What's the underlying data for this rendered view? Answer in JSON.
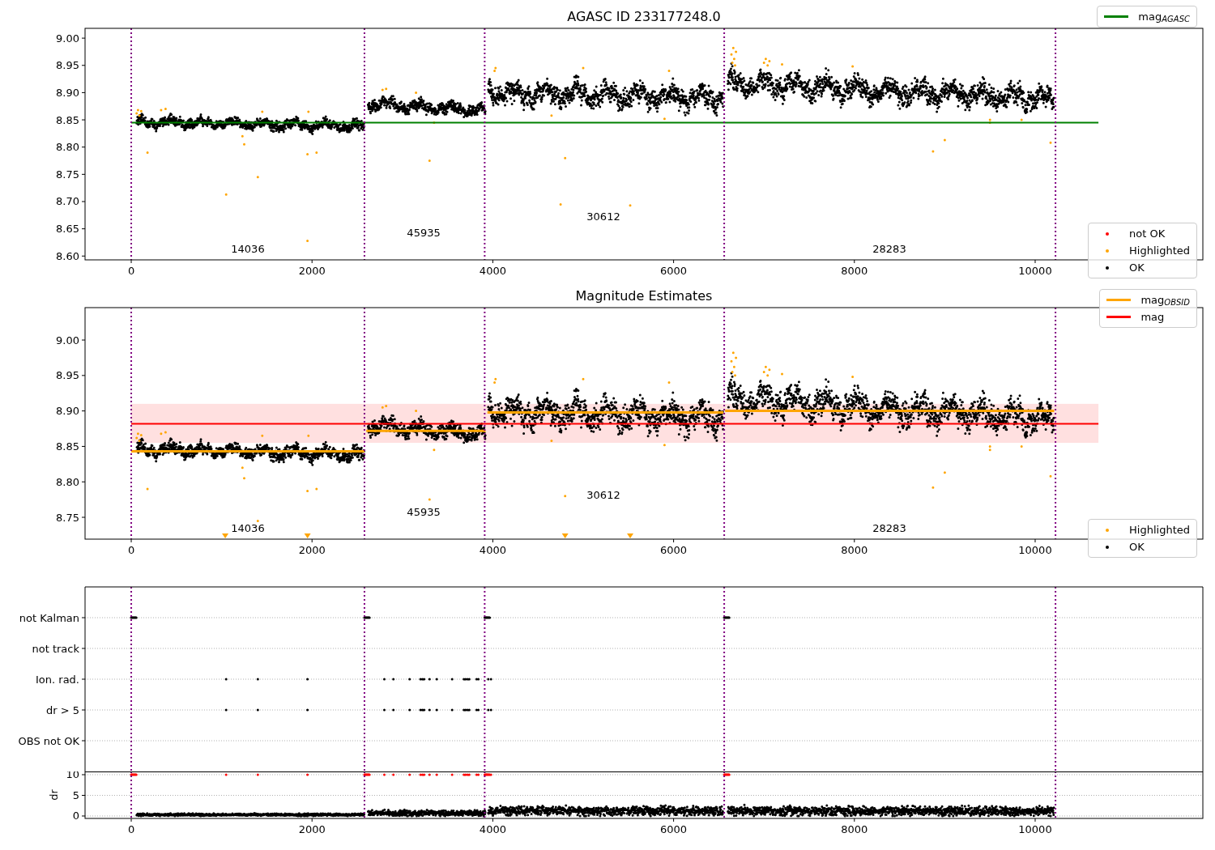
{
  "panels": [
    {
      "kind": "magnitude",
      "title": "AGASC ID 233177248.0",
      "chart_data": {
        "type": "line",
        "x": [
          0,
          10700
        ],
        "xlim": [
          -511,
          11855
        ],
        "ylim": [
          8.593,
          9.018
        ],
        "xticks": [
          0,
          2000,
          4000,
          6000,
          8000,
          10000
        ],
        "yticks": [
          {
            "value": 8.6,
            "label": "8.60"
          },
          {
            "value": 8.65,
            "label": "8.65"
          },
          {
            "value": 8.7,
            "label": "8.70"
          },
          {
            "value": 8.75,
            "label": "8.75"
          },
          {
            "value": 8.8,
            "label": "8.80"
          },
          {
            "value": 8.85,
            "label": "8.85"
          },
          {
            "value": 8.9,
            "label": "8.90"
          },
          {
            "value": 8.95,
            "label": "8.95"
          },
          {
            "value": 9.0,
            "label": "9.00"
          }
        ],
        "series": [
          {
            "name": "mag$_{AGASC}$",
            "color": "#008000",
            "values": [
              8.845,
              8.845
            ]
          }
        ],
        "ref_lines": [
          {
            "axis": "x",
            "value": 0,
            "color": "#800080"
          },
          {
            "axis": "x",
            "value": 2580,
            "color": "#800080"
          },
          {
            "axis": "x",
            "value": 3910,
            "color": "#800080"
          },
          {
            "axis": "x",
            "value": 6560,
            "color": "#800080"
          },
          {
            "axis": "x",
            "value": 10225,
            "color": "#800080"
          }
        ],
        "annotations": [
          "14036",
          "45935",
          "30612",
          "28283"
        ]
      },
      "marker_legend": [
        {
          "label": "not OK",
          "color": "#ff0000"
        },
        {
          "label": "Highlighted",
          "color": "#ffa500"
        },
        {
          "label": "OK",
          "color": "#000000"
        }
      ]
    },
    {
      "kind": "magnitude",
      "title": "Magnitude Estimates",
      "chart_data": {
        "type": "line",
        "x": [
          0,
          2580,
          2590,
          2600,
          3920,
          3930,
          3940,
          6550,
          6560,
          6570,
          10210,
          10700
        ],
        "xlim": [
          -511,
          11855
        ],
        "ylim": [
          8.7192,
          9.0457
        ],
        "xticks": [
          0,
          2000,
          4000,
          6000,
          8000,
          10000
        ],
        "yticks": [
          {
            "value": 8.75,
            "label": "8.75"
          },
          {
            "value": 8.8,
            "label": "8.80"
          },
          {
            "value": 8.85,
            "label": "8.85"
          },
          {
            "value": 8.9,
            "label": "8.90"
          },
          {
            "value": 8.95,
            "label": "8.95"
          },
          {
            "value": 9.0,
            "label": "9.00"
          }
        ],
        "series": [
          {
            "name": "mag$_{OBSID}$",
            "color": "#ffa500",
            "values": [
              8.843,
              8.843,
              null,
              8.872,
              8.872,
              null,
              8.898,
              8.898,
              null,
              8.9,
              8.9,
              null
            ]
          },
          {
            "name": "mag",
            "color": "#ff0000",
            "values": [
              8.882,
              8.882,
              8.882,
              8.882,
              8.882,
              8.882,
              8.882,
              8.882,
              8.882,
              8.882,
              8.882,
              8.882
            ]
          }
        ],
        "bands": [
          {
            "axis": "y",
            "from": 8.855,
            "to": 8.91,
            "color": "#ff0000"
          }
        ],
        "ref_lines": [
          {
            "axis": "x",
            "value": 0,
            "color": "#800080"
          },
          {
            "axis": "x",
            "value": 2580,
            "color": "#800080"
          },
          {
            "axis": "x",
            "value": 3910,
            "color": "#800080"
          },
          {
            "axis": "x",
            "value": 6560,
            "color": "#800080"
          },
          {
            "axis": "x",
            "value": 10225,
            "color": "#800080"
          }
        ],
        "annotations": [
          "14036",
          "45935",
          "30612",
          "28283"
        ]
      },
      "marker_legend": [
        {
          "label": "Highlighted",
          "color": "#ffa500"
        },
        {
          "label": "OK",
          "color": "#000000"
        }
      ]
    },
    {
      "kind": "flags",
      "flag_rows": [
        {
          "label": "not Kalman"
        },
        {
          "label": "not track"
        },
        {
          "label": "Ion. rad."
        },
        {
          "label": "dr > 5"
        },
        {
          "label": "OBS not OK"
        }
      ],
      "chart_data": {
        "type": "scatter",
        "ylabel": "dr",
        "xlim": [
          -511,
          11855
        ],
        "ylim": [
          -0.59,
          10.78
        ],
        "xticks": [
          0,
          2000,
          4000,
          6000,
          8000,
          10000
        ],
        "yticks": [
          0,
          5,
          10
        ],
        "grid": true,
        "ref_lines": [
          {
            "axis": "x",
            "value": 0,
            "color": "#800080"
          },
          {
            "axis": "x",
            "value": 2580,
            "color": "#800080"
          },
          {
            "axis": "x",
            "value": 3910,
            "color": "#800080"
          },
          {
            "axis": "x",
            "value": 6560,
            "color": "#800080"
          },
          {
            "axis": "x",
            "value": 10225,
            "color": "#800080"
          }
        ]
      }
    }
  ]
}
